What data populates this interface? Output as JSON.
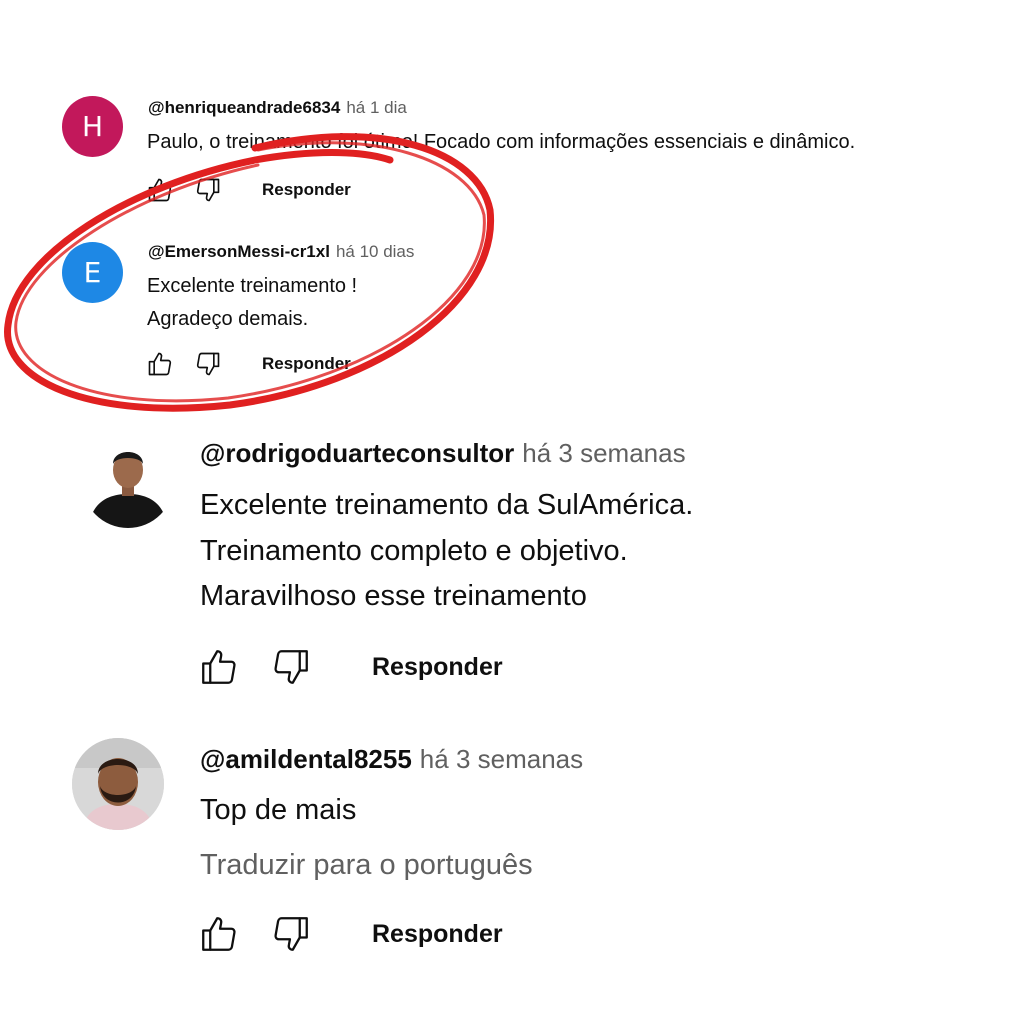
{
  "comments": [
    {
      "avatar_letter": "H",
      "avatar_color": "#c2185b",
      "author": "@henriqueandrade6834",
      "time": "há 1 dia",
      "lines": [
        "Paulo, o treinamento foi ótimo! Focado com informações essenciais e dinâmico."
      ],
      "reply_label": "Responder"
    },
    {
      "avatar_letter": "E",
      "avatar_color": "#1e88e5",
      "author": "@EmersonMessi-cr1xl",
      "time": "há 10 dias",
      "lines": [
        "Excelente treinamento !",
        "Agradeço demais."
      ],
      "reply_label": "Responder"
    },
    {
      "avatar_photo": "person-photo-dark-shirt",
      "author": "@rodrigoduarteconsultor",
      "time": "há 3 semanas",
      "lines": [
        "Excelente treinamento da SulAmérica.",
        "Treinamento completo e objetivo.",
        "Maravilhoso esse treinamento"
      ],
      "reply_label": "Responder"
    },
    {
      "avatar_photo": "person-photo-bearded",
      "author": "@amildental8255",
      "time": "há 3 semanas",
      "lines": [
        "Top de mais"
      ],
      "translate_label": "Traduzir para o português",
      "reply_label": "Responder"
    }
  ],
  "highlight_color": "#e02020",
  "icons": [
    "like-icon",
    "dislike-icon"
  ]
}
